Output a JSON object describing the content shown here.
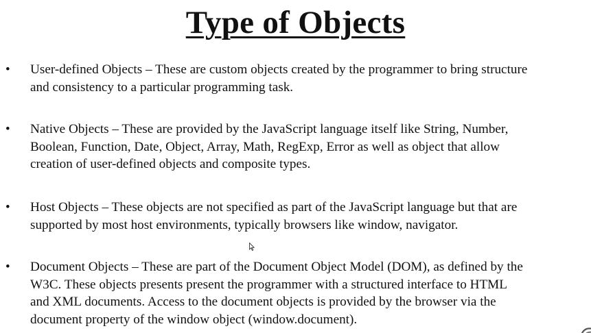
{
  "title": "Type of Objects",
  "bullet_symbol": "•",
  "items": [
    {
      "lines": [
        "User-defined Objects – These are custom objects created by the programmer to bring structure",
        "and consistency to a particular programming task."
      ]
    },
    {
      "lines": [
        "Native Objects – These are provided by the JavaScript language itself like String, Number,",
        "Boolean, Function, Date, Object, Array, Math, RegExp, Error as well as object that allow",
        "creation of user-defined objects and composite types."
      ]
    },
    {
      "lines": [
        "Host Objects – These objects are not specified as part of the JavaScript language but that are",
        "supported by most host environments, typically browsers like window, navigator."
      ]
    },
    {
      "lines": [
        "Document Objects – These are part of the Document Object Model (DOM), as defined by the",
        "W3C. These objects presents present the programmer with a structured interface to HTML",
        "and XML documents. Access to the document objects is provided by the browser via the",
        "document  property of the window object (window.document)."
      ]
    }
  ],
  "icons": {
    "cursor": "mouse-pointer-icon",
    "corner": "watermark-logo-icon"
  }
}
